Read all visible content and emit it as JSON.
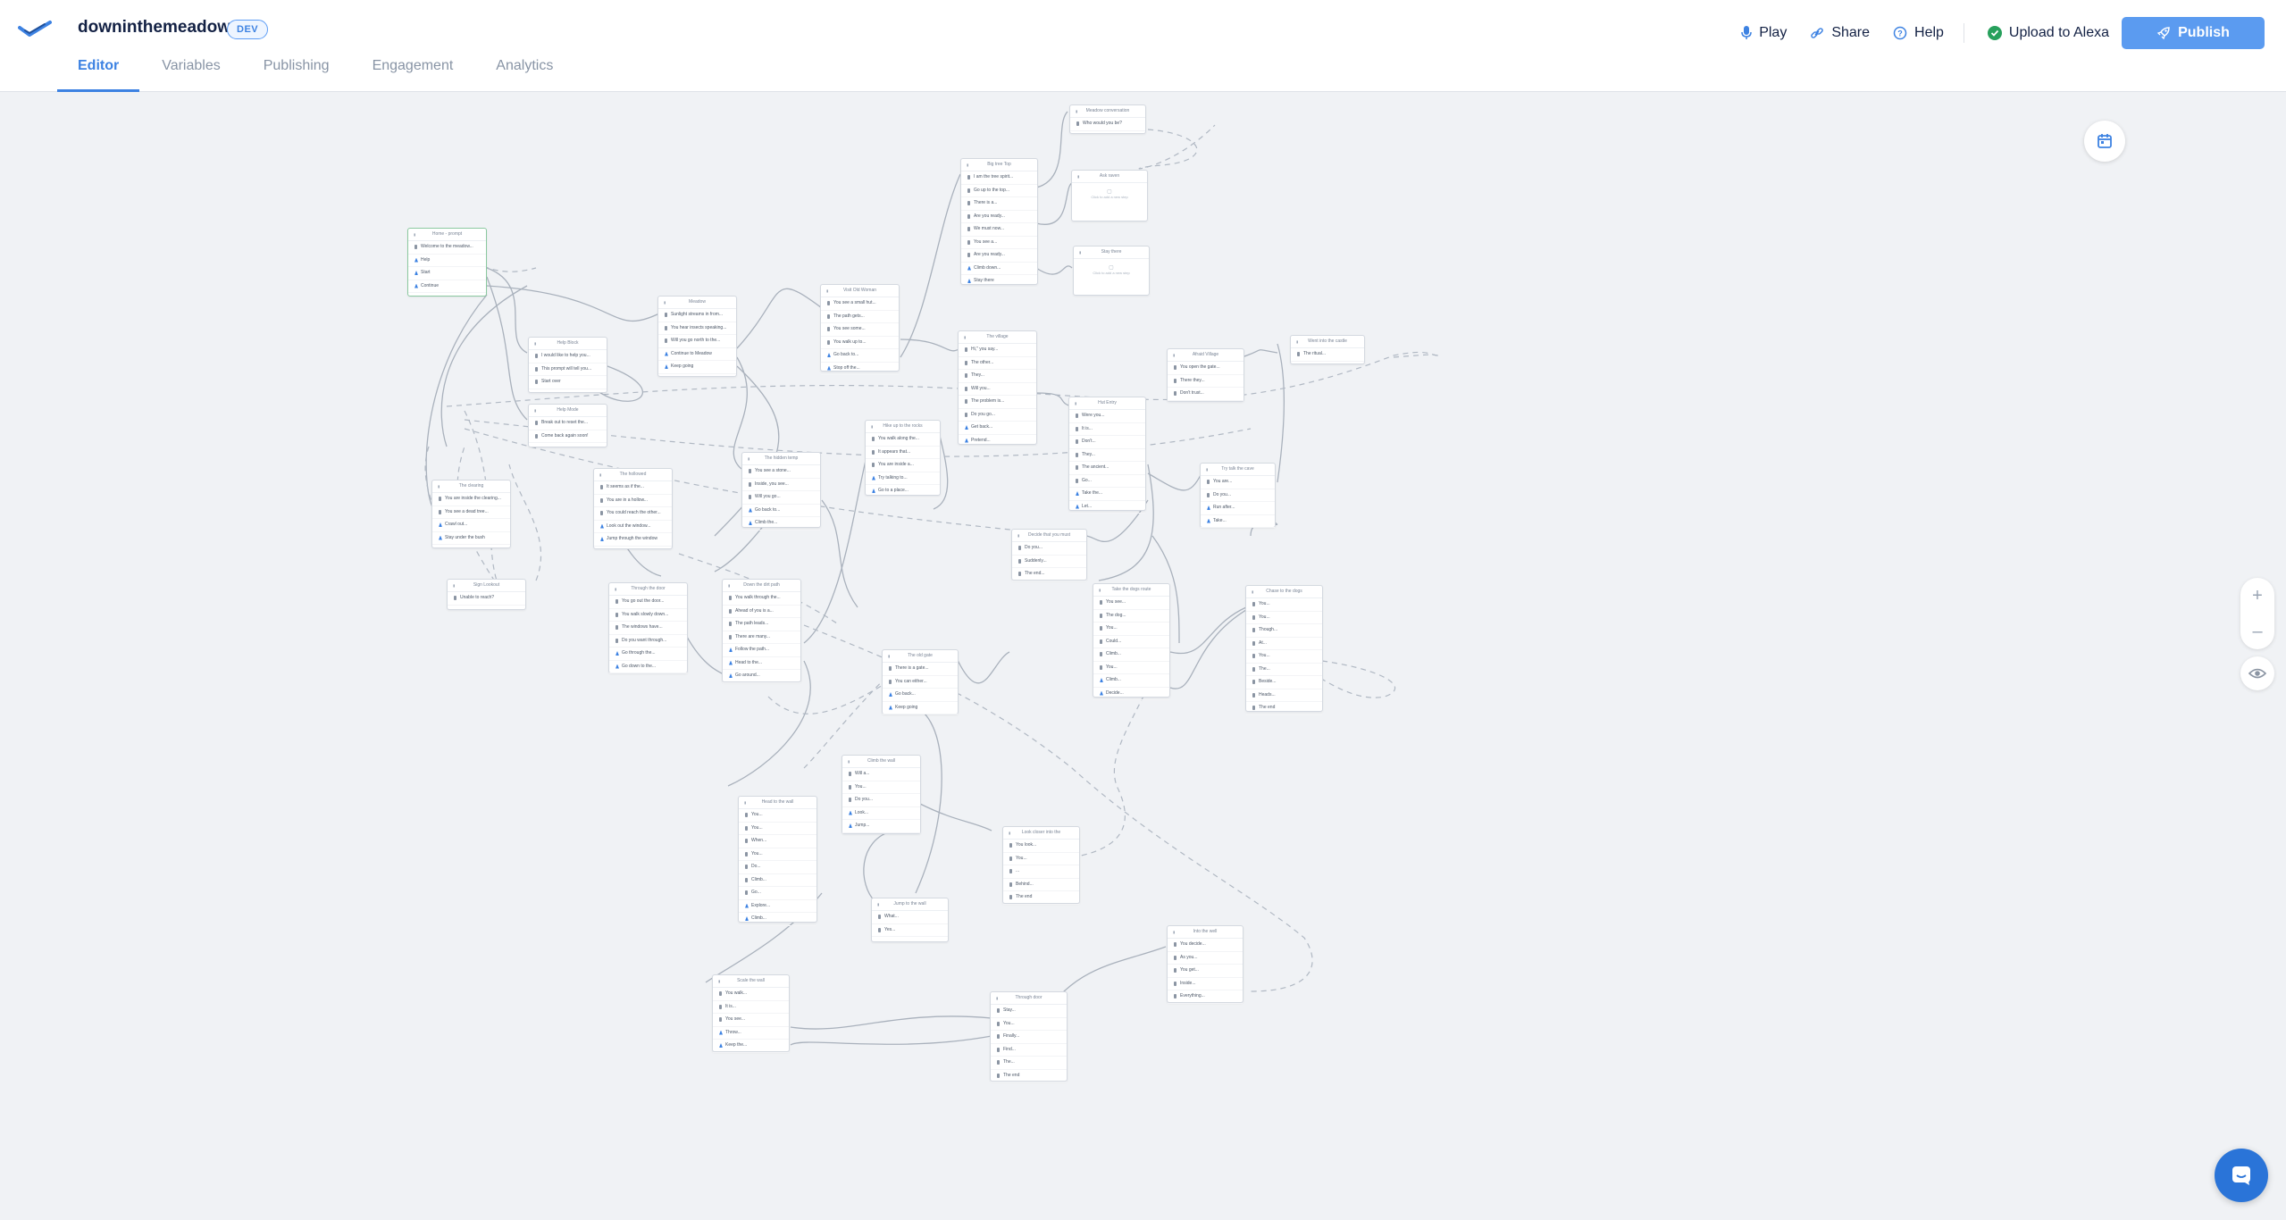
{
  "app": {
    "project_name": "downinthemeadow",
    "env_badge": "DEV"
  },
  "tabs": [
    {
      "label": "Editor",
      "active": true
    },
    {
      "label": "Variables",
      "active": false
    },
    {
      "label": "Publishing",
      "active": false
    },
    {
      "label": "Engagement",
      "active": false
    },
    {
      "label": "Analytics",
      "active": false
    }
  ],
  "actions": {
    "play": "Play",
    "share": "Share",
    "help": "Help",
    "upload": "Upload to Alexa",
    "publish": "Publish"
  },
  "colors": {
    "accent": "#3d82e2",
    "publish_bg": "#5b9bf0",
    "start_border": "#8bc9a0",
    "success": "#27a05c"
  },
  "controls": {
    "zoom_in": "+",
    "zoom_out": "–"
  },
  "blocks": [
    {
      "title": "Home - prompt",
      "steps": [
        "Welcome to the meadow...",
        "Help",
        "Start",
        "Continue"
      ]
    },
    {
      "title": "Help Block",
      "steps": [
        "I would like to help you...",
        "This prompt will tell you...",
        "Start over"
      ]
    },
    {
      "title": "Help Mode",
      "steps": [
        "Break out to reset the...",
        "Come back again soon!"
      ]
    },
    {
      "title": "Meadow",
      "steps": [
        "Sunlight streams in from...",
        "You hear insects speaking...",
        "Will you go north to the...",
        "Continue to Meadow",
        "Keep going"
      ]
    },
    {
      "title": "The clearing",
      "steps": [
        "You are inside the clearing...",
        "You see a dead tree...",
        "Crawl out...",
        "Stay under the bush"
      ]
    },
    {
      "title": "Sign Lookout",
      "steps": [
        "Unable to reach?"
      ]
    },
    {
      "title": "The hollowed",
      "steps": [
        "It seems as if the...",
        "You are in a hollow...",
        "You could reach the other...",
        "Look out the window...",
        "Jump through the window"
      ]
    },
    {
      "title": "Through the door",
      "steps": [
        "You go out the door...",
        "You walk slowly down...",
        "The windows have...",
        "Do you want through...",
        "Go through the...",
        "Go down to the..."
      ]
    },
    {
      "title": "Down the dirt path",
      "steps": [
        "You walk through the...",
        "Ahead of you is a...",
        "The path leads...",
        "There are many...",
        "Follow the path...",
        "Head to the...",
        "Go around..."
      ]
    },
    {
      "title": "The old gate",
      "steps": [
        "There is a gate...",
        "You can either...",
        "Go back...",
        "Keep going"
      ]
    },
    {
      "title": "The hidden temp",
      "steps": [
        "You see a stone...",
        "Inside, you see...",
        "Will you go...",
        "Go back to...",
        "Climb the..."
      ]
    },
    {
      "title": "Hike up to the rocks",
      "steps": [
        "You walk along the...",
        "It appears that...",
        "You are inside a...",
        "Try talking to...",
        "Go to a place..."
      ]
    },
    {
      "title": "Visit Old Woman",
      "steps": [
        "You see a small hut...",
        "The path gets...",
        "You see some...",
        "You walk up to...",
        "Go back to...",
        "Stop off the..."
      ]
    },
    {
      "title": "Big tree Top",
      "steps": [
        "I am the tree spirit...",
        "Go up to the top...",
        "There is a...",
        "Are you ready...",
        "We must now...",
        "You see a...",
        "Are you ready...",
        "Climb down...",
        "Stay there"
      ]
    },
    {
      "title": "Meadow conversation",
      "steps": [
        "Who would you be?"
      ]
    },
    {
      "title": "The village",
      "steps": [
        "Hi,\" you say...",
        "The other...",
        "They...",
        "Will you...",
        "The problem is...",
        "Do you go...",
        "Get back...",
        "Pretend..."
      ]
    },
    {
      "title": "Afraid Village",
      "steps": [
        "You open the gate...",
        "There they...",
        "Don't trust..."
      ]
    },
    {
      "title": "Went into the castle",
      "steps": [
        "The ritual..."
      ]
    },
    {
      "title": "Hut Entry",
      "steps": [
        "Were you...",
        "It is...",
        "Don't...",
        "They...",
        "The ancient...",
        "Go...",
        "Take the...",
        "Let..."
      ]
    },
    {
      "title": "Try talk the cave",
      "steps": [
        "You are...",
        "Do you...",
        "Run after...",
        "Take..."
      ]
    },
    {
      "title": "Decide that you must",
      "steps": [
        "Do you...",
        "Suddenly...",
        "The end..."
      ]
    },
    {
      "title": "Take the dogs route",
      "steps": [
        "You see...",
        "The dog...",
        "You...",
        "Could...",
        "Climb...",
        "You...",
        "Climb...",
        "Decide..."
      ]
    },
    {
      "title": "Chase to the dogs",
      "steps": [
        "You...",
        "You...",
        "Though...",
        "At...",
        "You...",
        "The...",
        "Beside...",
        "Heads...",
        "The end"
      ]
    },
    {
      "title": "Climb the wall",
      "steps": [
        "Will a...",
        "You...",
        "Do you...",
        "Look...",
        "Jump..."
      ]
    },
    {
      "title": "Head to the wall",
      "steps": [
        "You...",
        "You...",
        "When...",
        "You...",
        "Do...",
        "Climb...",
        "Go...",
        "Explore...",
        "Climb..."
      ]
    },
    {
      "title": "Look closer into the",
      "steps": [
        "You look...",
        "You...",
        "...",
        "Behind...",
        "The end"
      ]
    },
    {
      "title": "Jump to the wall",
      "steps": [
        "What...",
        "Yes..."
      ]
    },
    {
      "title": "Into the well",
      "steps": [
        "You decide...",
        "As you...",
        "You get...",
        "Inside...",
        "Everything..."
      ]
    },
    {
      "title": "Scale the wall",
      "steps": [
        "You walk...",
        "It is...",
        "You see...",
        "Throw...",
        "Keep the..."
      ]
    },
    {
      "title": "Through door",
      "steps": [
        "Stay...",
        "You...",
        "Finally...",
        "Find...",
        "The...",
        "The end"
      ]
    },
    {
      "title": "Ask raven",
      "steps": [],
      "empty_text": "Click to add a new step"
    },
    {
      "title": "Stay there",
      "steps": [],
      "empty_text": "Click to add a new step"
    }
  ]
}
